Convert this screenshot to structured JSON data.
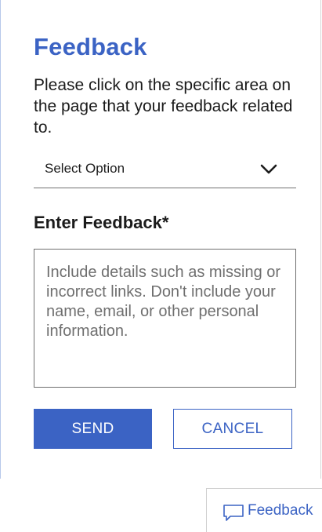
{
  "dialog": {
    "title": "Feedback",
    "instructions": "Please click on the specific area on the page that your feedback related to.",
    "select": {
      "selected": "Select Option",
      "icon": "chevron-down-icon"
    },
    "feedback_label": "Enter Feedback*",
    "feedback_input": {
      "value": "",
      "placeholder": "Include details such as missing or incorrect links. Don't include your name, email, or other personal information."
    },
    "send_label": "SEND",
    "cancel_label": "CANCEL"
  },
  "floating_button": {
    "label": "Feedback",
    "icon": "speech-bubble-icon"
  },
  "colors": {
    "accent": "#3b63c4",
    "text": "#1b1b1b",
    "placeholder": "#6f6f6f",
    "border": "#707070"
  }
}
